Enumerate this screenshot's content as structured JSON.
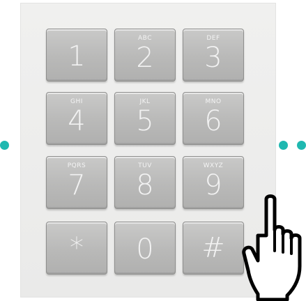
{
  "keypad": {
    "keys": [
      {
        "digit": "1",
        "letters": ""
      },
      {
        "digit": "2",
        "letters": "ABC"
      },
      {
        "digit": "3",
        "letters": "DEF"
      },
      {
        "digit": "4",
        "letters": "GHI"
      },
      {
        "digit": "5",
        "letters": "JKL"
      },
      {
        "digit": "6",
        "letters": "MNO"
      },
      {
        "digit": "7",
        "letters": "PQRS"
      },
      {
        "digit": "8",
        "letters": "TUV"
      },
      {
        "digit": "9",
        "letters": "WXYZ"
      },
      {
        "digit": "*",
        "letters": ""
      },
      {
        "digit": "0",
        "letters": ""
      },
      {
        "digit": "#",
        "letters": ""
      }
    ]
  },
  "colors": {
    "accent_dot": "#1fb8b0",
    "key_face": "#bdbdbc",
    "key_label": "#f2f2f2"
  },
  "icons": {
    "cursor": "pointing-hand-icon"
  }
}
